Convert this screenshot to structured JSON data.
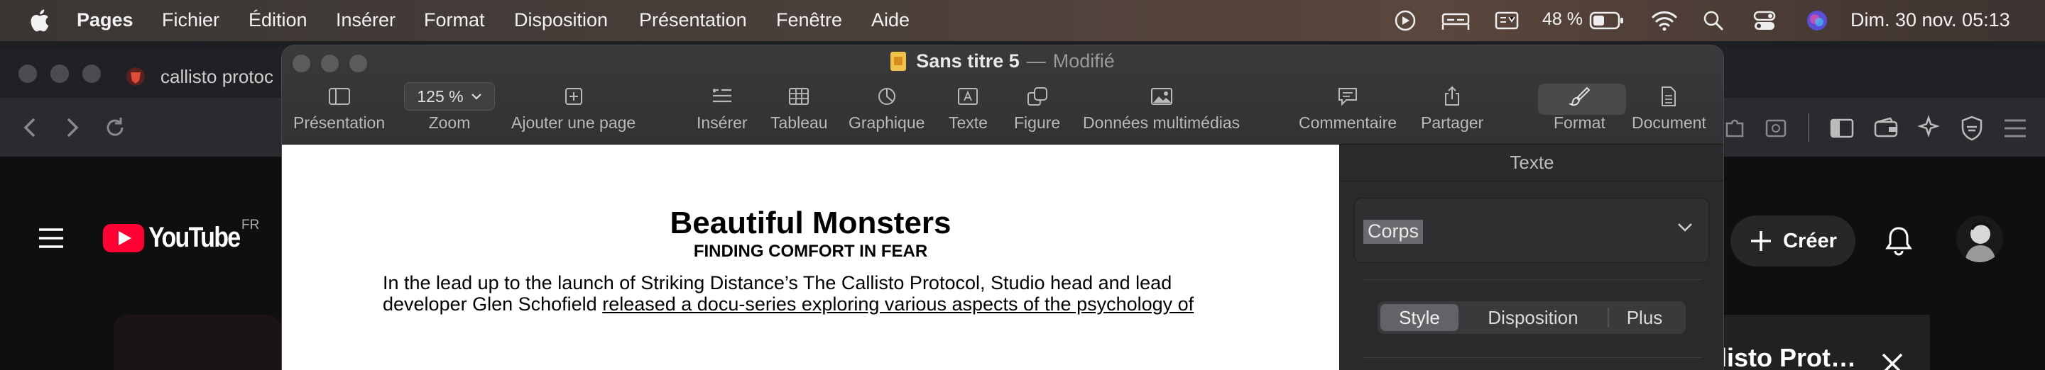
{
  "menubar": {
    "app_name": "Pages",
    "items": [
      "Fichier",
      "Édition",
      "Insérer",
      "Format",
      "Disposition",
      "Présentation",
      "Fenêtre",
      "Aide"
    ],
    "battery_percent": "48 %",
    "datetime": "Dim. 30 nov.  05:13"
  },
  "browser": {
    "tab_title": "callisto protoc",
    "youtube": {
      "logo_text": "YouTube",
      "region": "FR",
      "create_label": "Créer",
      "card_title": "listo Prot…"
    }
  },
  "pages": {
    "doc_name": "Sans titre 5",
    "title_sep": "—",
    "status": "Modifié",
    "toolbar": {
      "view": "Présentation",
      "zoom_value": "125 %",
      "zoom": "Zoom",
      "add_page": "Ajouter une page",
      "insert": "Insérer",
      "table": "Tableau",
      "chart": "Graphique",
      "text": "Texte",
      "shape": "Figure",
      "media": "Données multimédias",
      "comment": "Commentaire",
      "share": "Partager",
      "format": "Format",
      "document": "Document"
    },
    "document": {
      "title": "Beautiful Monsters",
      "subtitle": "FINDING COMFORT IN FEAR",
      "body_line1": "In the lead up to the launch of Striking Distance’s The Callisto Protocol, Studio head and lead",
      "body_line2_plain": "developer Glen Schofield ",
      "body_line2_link": "released a docu-series exploring various aspects of the psychology of"
    },
    "inspector": {
      "tab": "Texte",
      "paragraph_style": "Corps",
      "segments": [
        "Style",
        "Disposition",
        "Plus"
      ],
      "active_segment": "Style"
    }
  },
  "colors": {
    "youtube_red": "#ff0033",
    "doc_icon": "#f0c44a"
  }
}
